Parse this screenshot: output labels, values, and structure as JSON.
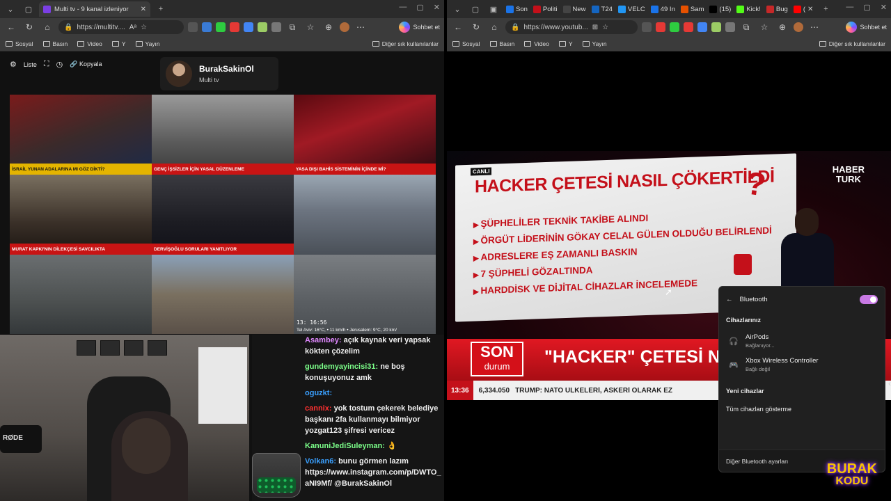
{
  "left_window": {
    "tab": {
      "title": "Multi tv - 9 kanal izleniyor",
      "fav_color": "#7b3fe4"
    },
    "address": "https://multitv....",
    "copilot_label": "Sohbet et",
    "bookmarks": [
      "Sosyal",
      "Basın",
      "Video",
      "Y",
      "Yayın"
    ],
    "bookmarks_right": "Diğer sık kullanılanlar"
  },
  "right_window": {
    "tabs": [
      {
        "title": "Son",
        "fav_color": "#1a73e8"
      },
      {
        "title": "Politi",
        "fav_color": "#c4101a"
      },
      {
        "title": "New",
        "fav_color": "#444444"
      },
      {
        "title": "T24",
        "fav_color": "#1565c0"
      },
      {
        "title": "VELC",
        "fav_color": "#2196f3"
      },
      {
        "title": "49 In",
        "fav_color": "#1a73e8"
      },
      {
        "title": "Sam",
        "fav_color": "#e65100"
      },
      {
        "title": "(15)",
        "fav_color": "#000000"
      },
      {
        "title": "Kick!",
        "fav_color": "#53fc18"
      },
      {
        "title": "Bug",
        "fav_color": "#c62828"
      },
      {
        "title": "(",
        "fav_color": "#ff0000"
      }
    ],
    "address": "https://www.youtub...",
    "copilot_label": "Sohbet et",
    "bookmarks": [
      "Sosyal",
      "Basın",
      "Video",
      "Y",
      "Yayın"
    ],
    "bookmarks_right": "Diğer sık kullanılanlar"
  },
  "multitv": {
    "toolbar": {
      "list_label": "Liste",
      "copy_label": "Kopyala"
    },
    "user": {
      "name": "BurakSakinOl",
      "subtitle": "Multi tv"
    },
    "cells": [
      {
        "ticker": "İSRAİL YUNAN ADALARINA MI GÖZ DİKTİ?",
        "ticker_style": "yellow",
        "bg": "linear-gradient(160deg,#7a1b1b,#3b2a2a 50%,#1b2a4a)"
      },
      {
        "ticker": "GENÇ İŞSİZLER İÇİN YASAL DÜZENLEME",
        "ticker_style": "red",
        "bg": "linear-gradient(180deg,#9a9a9a,#5a5a5a 60%,#3a3a3a)"
      },
      {
        "ticker": "YASA DIŞI BAHİS SİSTEMİNİN İÇİNDE Mİ?",
        "ticker_style": "red",
        "bg": "linear-gradient(160deg,#5a0a10,#a01a24 40%,#2a0a10)"
      },
      {
        "ticker": "MURAT KAPKI'NIN DİLEKÇESİ SAVCILIKTA",
        "ticker_style": "red",
        "bg": "linear-gradient(180deg,#7a7060,#3a3028 60%,#1a1410)"
      },
      {
        "ticker": "DERVİŞOĞLU SORULARI YANITLIYOR",
        "ticker_style": "red",
        "bg": "linear-gradient(180deg,#3a3a40,#1c1c22 60%,#101018)"
      },
      {
        "ticker": "",
        "ticker_style": "none",
        "bg": "linear-gradient(180deg,#9aa6b2,#6c7480 45%,#4a5058)"
      },
      {
        "ticker": "",
        "ticker_style": "none",
        "bg": "linear-gradient(180deg,#6a6e70,#4c5050 60%,#34383a)"
      },
      {
        "ticker": "",
        "ticker_style": "none",
        "bg": "linear-gradient(180deg,#8aa0b8,#7a7060 50%,#5a5048)"
      },
      {
        "ticker": "",
        "ticker_style": "none",
        "bg": "linear-gradient(180deg,#7a7e82,#5a5e62 60%,#4a4e52)",
        "timestamp": "13: 16:56",
        "caption": "Tel Aviv: 16°C, • 11 km/h • Jerusalem: 9°C, 20 km/"
      }
    ]
  },
  "chat": [
    {
      "nick": "Asambey:",
      "nick_color": "#e088ff",
      "text": " açık kaynak veri yapsak kökten çözelim"
    },
    {
      "nick": "gundemyayincisi31:",
      "nick_color": "#7cff8a",
      "text": " ne boş konuşuyonuz amk"
    },
    {
      "nick": "oguzkt:",
      "nick_color": "#3aa0ff",
      "text": ""
    },
    {
      "nick": "cannix:",
      "nick_color": "#ff3030",
      "text": " yok tostum çekerek belediye başkanı 2fa kullanmayı bilmiyor yozgat123 şifresi vericez"
    },
    {
      "nick": "KanuniJediSuleyman:",
      "nick_color": "#7cff8a",
      "text": " 👌"
    },
    {
      "nick": "Volkan6:",
      "nick_color": "#3aa0ff",
      "text": " bunu görmen lazım https://www.instagram.com/p/DWTO_aNI9Mf/ @BurakSakinOl"
    }
  ],
  "webcam": {
    "mic_label": "RØDE"
  },
  "broadcast": {
    "canli": "CANLI",
    "headline": "HACKER ÇETESİ NASIL ÇÖKERTİLDİ",
    "qmark": "?",
    "bullets": [
      "ŞÜPHELİLER TEKNİK TAKİBE ALINDI",
      "ÖRGÜT LİDERİNİN GÖKAY CELAL GÜLEN OLDUĞU BELİRLENDİ",
      "ADRESLERE EŞ ZAMANLI BASKIN",
      "7 ŞÜPHELİ GÖZALTINDA",
      "HARDDİSK VE DİJİTAL CİHAZLAR İNCELEMEDE"
    ],
    "logo_line1": "HABER",
    "logo_line2": "TURK",
    "son": "SON",
    "durum": "durum",
    "banner": "\"HACKER\" ÇETESİ NA",
    "tick_time": "13:36",
    "tick_bist": "6,334.050",
    "tick_news": "TRUMP: NATO ÜLKELERİ, ASKERİ OLARAK EZ"
  },
  "bluetooth": {
    "title": "Bluetooth",
    "devices_header": "Cihazlarınız",
    "devices": [
      {
        "name": "AirPods",
        "status": "Bağlanıyor...",
        "icon": "headphones-icon"
      },
      {
        "name": "Xbox Wireless Controller",
        "status": "Bağlı değil",
        "icon": "gamepad-icon"
      }
    ],
    "new_header": "Yeni cihazlar",
    "show_all": "Tüm cihazları gösterme",
    "footer": "Diğer Bluetooth ayarları"
  },
  "brand": {
    "line1": "BURAK",
    "line2": "KODU"
  }
}
